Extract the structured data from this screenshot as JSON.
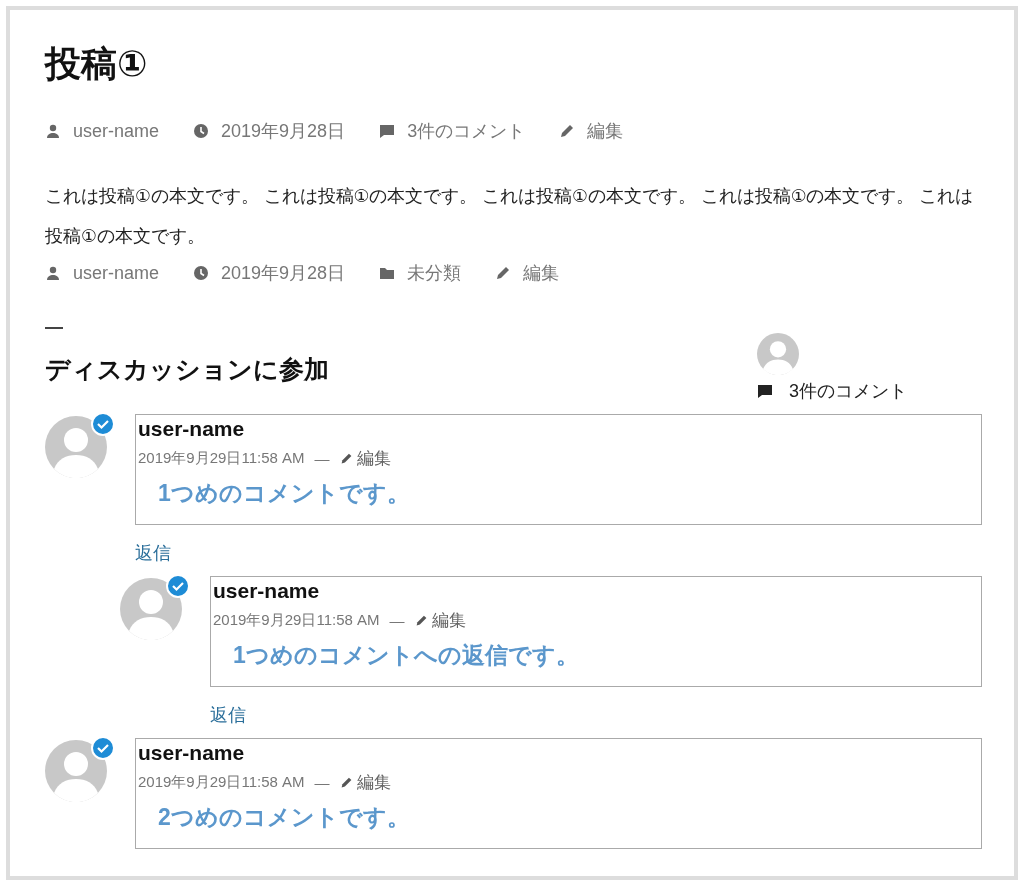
{
  "post": {
    "title": "投稿①",
    "meta_top": [
      {
        "kind": "author",
        "text": "user-name"
      },
      {
        "kind": "date",
        "text": "2019年9月28日"
      },
      {
        "kind": "comments",
        "text": "3件のコメント"
      },
      {
        "kind": "edit",
        "text": "編集"
      }
    ],
    "body": "これは投稿①の本文です。 これは投稿①の本文です。 これは投稿①の本文です。 これは投稿①の本文です。 これは投稿①の本文です。",
    "meta_bottom": [
      {
        "kind": "author",
        "text": "user-name"
      },
      {
        "kind": "date",
        "text": "2019年9月28日"
      },
      {
        "kind": "category",
        "text": "未分類"
      },
      {
        "kind": "edit",
        "text": "編集"
      }
    ]
  },
  "discussion": {
    "heading": "ディスカッションに参加",
    "comment_count": "3件のコメント"
  },
  "comments": [
    {
      "author": "user-name",
      "verified": true,
      "date": "2019年9月29日11:58 AM",
      "separator": "—",
      "edit": "編集",
      "text": "1つめのコメントです。",
      "reply": "返信",
      "children": [
        {
          "author": "user-name",
          "verified": true,
          "date": "2019年9月29日11:58 AM",
          "separator": "—",
          "edit": "編集",
          "text": "1つめのコメントへの返信です。",
          "reply": "返信"
        }
      ]
    },
    {
      "author": "user-name",
      "verified": true,
      "date": "2019年9月29日11:58 AM",
      "separator": "—",
      "edit": "編集",
      "text": "2つめのコメントです。"
    }
  ]
}
